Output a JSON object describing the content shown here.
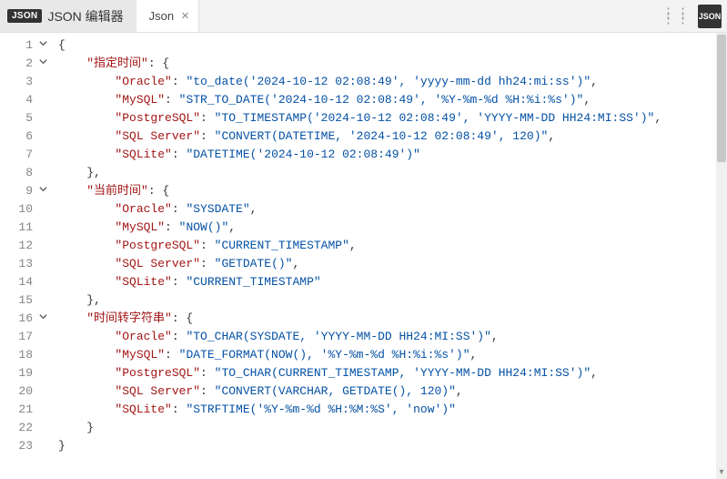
{
  "titlebar": {
    "badge": "JSON",
    "title": "JSON 编辑器",
    "tab_label": "Json",
    "tab_close": "×",
    "right_badge": "JSON"
  },
  "lines": [
    {
      "n": 1,
      "fold": true,
      "indent": 0,
      "parts": [
        {
          "t": "p",
          "v": "{"
        }
      ]
    },
    {
      "n": 2,
      "fold": true,
      "indent": 1,
      "parts": [
        {
          "t": "key",
          "v": "\"指定时间\""
        },
        {
          "t": "p",
          "v": ": {"
        }
      ]
    },
    {
      "n": 3,
      "fold": false,
      "indent": 2,
      "parts": [
        {
          "t": "key",
          "v": "\"Oracle\""
        },
        {
          "t": "p",
          "v": ": "
        },
        {
          "t": "str",
          "v": "\"to_date('2024-10-12 02:08:49', 'yyyy-mm-dd hh24:mi:ss')\""
        },
        {
          "t": "p",
          "v": ","
        }
      ]
    },
    {
      "n": 4,
      "fold": false,
      "indent": 2,
      "parts": [
        {
          "t": "key",
          "v": "\"MySQL\""
        },
        {
          "t": "p",
          "v": ": "
        },
        {
          "t": "str",
          "v": "\"STR_TO_DATE('2024-10-12 02:08:49', '%Y-%m-%d %H:%i:%s')\""
        },
        {
          "t": "p",
          "v": ","
        }
      ]
    },
    {
      "n": 5,
      "fold": false,
      "indent": 2,
      "parts": [
        {
          "t": "key",
          "v": "\"PostgreSQL\""
        },
        {
          "t": "p",
          "v": ": "
        },
        {
          "t": "str",
          "v": "\"TO_TIMESTAMP('2024-10-12 02:08:49', 'YYYY-MM-DD HH24:MI:SS')\""
        },
        {
          "t": "p",
          "v": ","
        }
      ]
    },
    {
      "n": 6,
      "fold": false,
      "indent": 2,
      "parts": [
        {
          "t": "key",
          "v": "\"SQL Server\""
        },
        {
          "t": "p",
          "v": ": "
        },
        {
          "t": "str",
          "v": "\"CONVERT(DATETIME, '2024-10-12 02:08:49', 120)\""
        },
        {
          "t": "p",
          "v": ","
        }
      ]
    },
    {
      "n": 7,
      "fold": false,
      "indent": 2,
      "parts": [
        {
          "t": "key",
          "v": "\"SQLite\""
        },
        {
          "t": "p",
          "v": ": "
        },
        {
          "t": "str",
          "v": "\"DATETIME('2024-10-12 02:08:49')\""
        }
      ]
    },
    {
      "n": 8,
      "fold": false,
      "indent": 1,
      "parts": [
        {
          "t": "p",
          "v": "},"
        }
      ]
    },
    {
      "n": 9,
      "fold": true,
      "indent": 1,
      "parts": [
        {
          "t": "key",
          "v": "\"当前时间\""
        },
        {
          "t": "p",
          "v": ": {"
        }
      ]
    },
    {
      "n": 10,
      "fold": false,
      "indent": 2,
      "parts": [
        {
          "t": "key",
          "v": "\"Oracle\""
        },
        {
          "t": "p",
          "v": ": "
        },
        {
          "t": "str",
          "v": "\"SYSDATE\""
        },
        {
          "t": "p",
          "v": ","
        }
      ]
    },
    {
      "n": 11,
      "fold": false,
      "indent": 2,
      "parts": [
        {
          "t": "key",
          "v": "\"MySQL\""
        },
        {
          "t": "p",
          "v": ": "
        },
        {
          "t": "str",
          "v": "\"NOW()\""
        },
        {
          "t": "p",
          "v": ","
        }
      ]
    },
    {
      "n": 12,
      "fold": false,
      "indent": 2,
      "parts": [
        {
          "t": "key",
          "v": "\"PostgreSQL\""
        },
        {
          "t": "p",
          "v": ": "
        },
        {
          "t": "str",
          "v": "\"CURRENT_TIMESTAMP\""
        },
        {
          "t": "p",
          "v": ","
        }
      ]
    },
    {
      "n": 13,
      "fold": false,
      "indent": 2,
      "parts": [
        {
          "t": "key",
          "v": "\"SQL Server\""
        },
        {
          "t": "p",
          "v": ": "
        },
        {
          "t": "str",
          "v": "\"GETDATE()\""
        },
        {
          "t": "p",
          "v": ","
        }
      ]
    },
    {
      "n": 14,
      "fold": false,
      "indent": 2,
      "parts": [
        {
          "t": "key",
          "v": "\"SQLite\""
        },
        {
          "t": "p",
          "v": ": "
        },
        {
          "t": "str",
          "v": "\"CURRENT_TIMESTAMP\""
        }
      ]
    },
    {
      "n": 15,
      "fold": false,
      "indent": 1,
      "parts": [
        {
          "t": "p",
          "v": "},"
        }
      ]
    },
    {
      "n": 16,
      "fold": true,
      "indent": 1,
      "parts": [
        {
          "t": "key",
          "v": "\"时间转字符串\""
        },
        {
          "t": "p",
          "v": ": {"
        }
      ]
    },
    {
      "n": 17,
      "fold": false,
      "indent": 2,
      "parts": [
        {
          "t": "key",
          "v": "\"Oracle\""
        },
        {
          "t": "p",
          "v": ": "
        },
        {
          "t": "str",
          "v": "\"TO_CHAR(SYSDATE, 'YYYY-MM-DD HH24:MI:SS')\""
        },
        {
          "t": "p",
          "v": ","
        }
      ]
    },
    {
      "n": 18,
      "fold": false,
      "indent": 2,
      "parts": [
        {
          "t": "key",
          "v": "\"MySQL\""
        },
        {
          "t": "p",
          "v": ": "
        },
        {
          "t": "str",
          "v": "\"DATE_FORMAT(NOW(), '%Y-%m-%d %H:%i:%s')\""
        },
        {
          "t": "p",
          "v": ","
        }
      ]
    },
    {
      "n": 19,
      "fold": false,
      "indent": 2,
      "parts": [
        {
          "t": "key",
          "v": "\"PostgreSQL\""
        },
        {
          "t": "p",
          "v": ": "
        },
        {
          "t": "str",
          "v": "\"TO_CHAR(CURRENT_TIMESTAMP, 'YYYY-MM-DD HH24:MI:SS')\""
        },
        {
          "t": "p",
          "v": ","
        }
      ]
    },
    {
      "n": 20,
      "fold": false,
      "indent": 2,
      "parts": [
        {
          "t": "key",
          "v": "\"SQL Server\""
        },
        {
          "t": "p",
          "v": ": "
        },
        {
          "t": "str",
          "v": "\"CONVERT(VARCHAR, GETDATE(), 120)\""
        },
        {
          "t": "p",
          "v": ","
        }
      ]
    },
    {
      "n": 21,
      "fold": false,
      "indent": 2,
      "parts": [
        {
          "t": "key",
          "v": "\"SQLite\""
        },
        {
          "t": "p",
          "v": ": "
        },
        {
          "t": "str",
          "v": "\"STRFTIME('%Y-%m-%d %H:%M:%S', 'now')\""
        }
      ]
    },
    {
      "n": 22,
      "fold": false,
      "indent": 1,
      "parts": [
        {
          "t": "p",
          "v": "}"
        }
      ]
    },
    {
      "n": 23,
      "fold": false,
      "indent": 0,
      "parts": [
        {
          "t": "p",
          "v": "}"
        }
      ]
    }
  ]
}
